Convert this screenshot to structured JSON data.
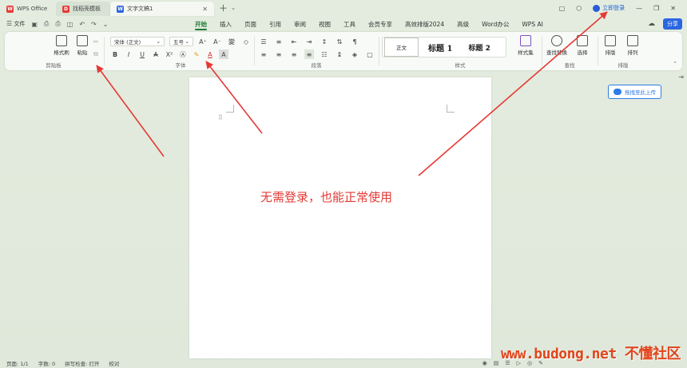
{
  "tabs": [
    {
      "label": "WPS Office",
      "icon": "wps-logo-icon",
      "color": "#e53935"
    },
    {
      "label": "找稻壳模板",
      "icon": "docer-icon",
      "color": "#e53935"
    },
    {
      "label": "文字文稿1",
      "icon": "word-doc-icon",
      "color": "#2b66e0"
    }
  ],
  "titlebar": {
    "login_label": "立即登录"
  },
  "menubar": {
    "file_label": "文件",
    "tabs": [
      "开始",
      "插入",
      "页面",
      "引用",
      "审阅",
      "视图",
      "工具",
      "会员专享",
      "高效排版2024",
      "高级",
      "Word办公",
      "WPS AI"
    ],
    "active_tab": "开始",
    "share_label": "分享"
  },
  "ribbon": {
    "clipboard": {
      "label": "剪贴板",
      "format_painter": "格式刷",
      "paste": "粘贴"
    },
    "font": {
      "label": "字体",
      "font_name": "宋体 (正文)",
      "font_size": "五号"
    },
    "paragraph": {
      "label": "段落"
    },
    "styles": {
      "label": "样式",
      "items": [
        "正文",
        "标题 1",
        "标题 2"
      ],
      "style_set": "样式集"
    },
    "find": {
      "label": "查找",
      "find_replace": "查找替换",
      "select": "选择"
    },
    "layout": {
      "label": "排版",
      "typeset": "排版",
      "arrange": "排列"
    }
  },
  "document": {
    "annotation": "无需登录，也能正常使用"
  },
  "side": {
    "upload_label": "拖拽至此上传"
  },
  "statusbar": {
    "page": "页面: 1/1",
    "words": "字数: 0",
    "spellcheck": "拼写检查: 打开",
    "proofread": "校对"
  },
  "watermark": "www.budong.net 不懂社区",
  "colors": {
    "accent": "#1f7a3a",
    "link": "#2b66e0",
    "annotation": "#e53935"
  }
}
